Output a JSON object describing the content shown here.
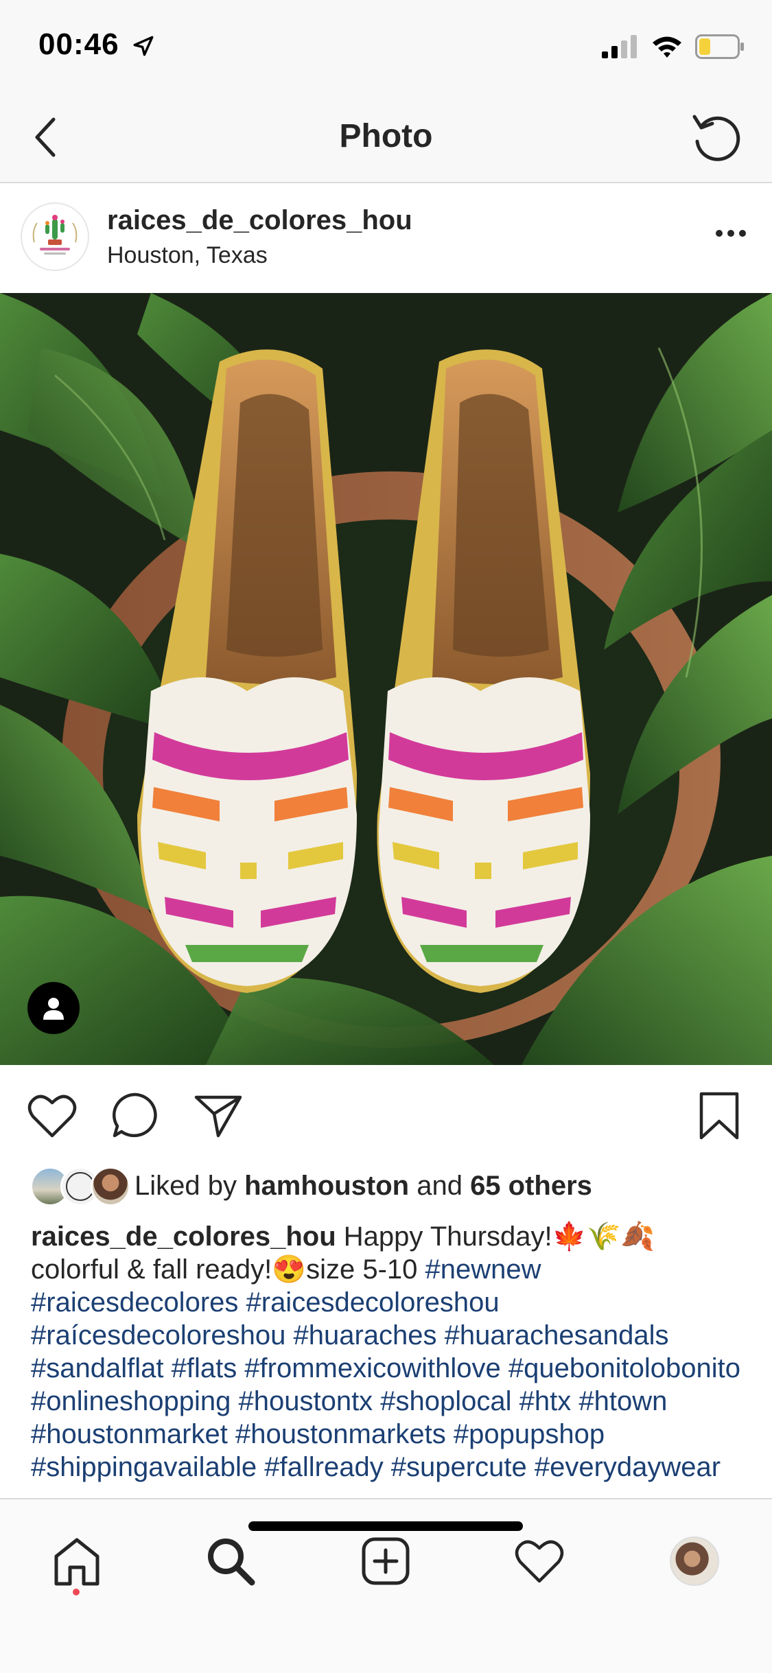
{
  "status": {
    "time": "00:46"
  },
  "nav": {
    "title": "Photo"
  },
  "post": {
    "username": "raices_de_colores_hou",
    "location": "Houston, Texas"
  },
  "likes": {
    "prefix": "Liked by ",
    "user": "hamhouston",
    "middle": " and ",
    "others": "65 others"
  },
  "caption": {
    "username": "raices_de_colores_hou",
    "text": "Happy Thursday!🍁🌾🍂 colorful & fall ready!😍size 5-10",
    "hashtags": "#newnew #raicesdecolores #raicesdecoloreshou #raícesdecoloreshou #huaraches #huarachesandals #sandalflat #flats #frommexicowithlove #quebonitolobonito #onlineshopping #houstontx #shoplocal #htx #htown #houstonmarket #houstonmarkets #popupshop #shippingavailable #fallready #supercute #everydaywear"
  },
  "icons": {
    "back": "chevron-left-icon",
    "refresh": "refresh-icon",
    "more": "more-dots-icon",
    "like": "heart-icon",
    "comment": "comment-icon",
    "share": "send-icon",
    "save": "bookmark-icon",
    "home": "home-icon",
    "search": "search-icon",
    "new_post": "add-post-icon",
    "activity": "heart-icon",
    "profile": "profile-avatar"
  },
  "colors": {
    "hashtag": "#1b3f73",
    "notification_dot": "#ed4956",
    "text": "#262626"
  }
}
